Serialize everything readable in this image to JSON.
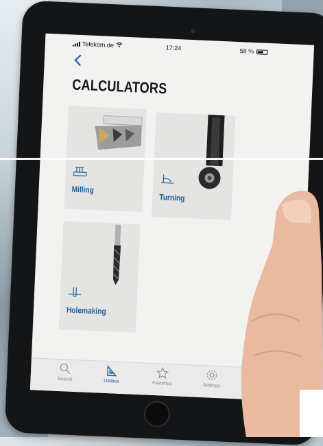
{
  "status_bar": {
    "carrier": "Telekom.de",
    "time": "17:24",
    "battery": "58 %"
  },
  "header": {
    "title": "CALCULATORS"
  },
  "tiles": [
    {
      "label": "Milling",
      "icon": "milling-icon"
    },
    {
      "label": "Turning",
      "icon": "turning-icon"
    },
    {
      "label": "Holemaking",
      "icon": "holemaking-icon"
    }
  ],
  "tab_bar": {
    "tabs": [
      {
        "label": "Search",
        "icon": "search-icon"
      },
      {
        "label": "Utilities",
        "icon": "utilities-icon",
        "active": true
      },
      {
        "label": "Favorites",
        "icon": "star-icon"
      },
      {
        "label": "Settings",
        "icon": "gear-icon"
      }
    ]
  },
  "colors": {
    "accent": "#1f5d99",
    "screen_background": "#f2f2f1",
    "tile_background": "#e4e4e3"
  }
}
